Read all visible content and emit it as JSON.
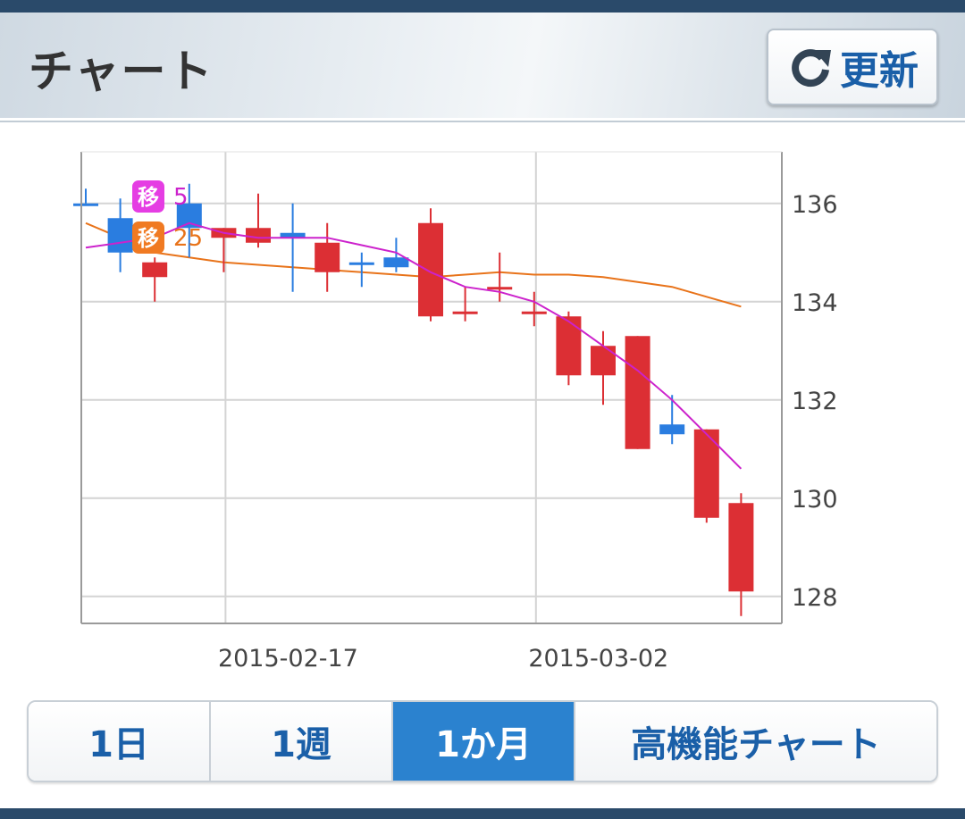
{
  "header": {
    "title": "チャート",
    "refresh_label": "更新",
    "refresh_icon": "refresh-icon"
  },
  "tabs": [
    {
      "label": "1日",
      "active": false
    },
    {
      "label": "1週",
      "active": false
    },
    {
      "label": "1か月",
      "active": true
    },
    {
      "label": "高機能チャート",
      "active": false
    }
  ],
  "chart_data": {
    "type": "candlestick",
    "y_ticks": [
      136,
      134,
      132,
      130,
      128
    ],
    "ylim": [
      127.45,
      137.05
    ],
    "x_tick_labels": [
      {
        "label": "2015-02-17",
        "index": 4
      },
      {
        "label": "2015-03-02",
        "index": 13
      }
    ],
    "grid": true,
    "legend": [
      {
        "badge": "移",
        "label": "5",
        "color": "#cc22cc",
        "badge_color": "#e53de3"
      },
      {
        "badge": "移",
        "label": "25",
        "color": "#e8731a",
        "badge_color": "#f07a22"
      }
    ],
    "colors": {
      "up": "#2a7de0",
      "down": "#dc2f34"
    },
    "candles": [
      {
        "o": 136.0,
        "h": 136.3,
        "l": 136.0,
        "c": 136.0,
        "dir": "up"
      },
      {
        "o": 135.0,
        "h": 136.1,
        "l": 134.6,
        "c": 135.7,
        "dir": "up"
      },
      {
        "o": 134.8,
        "h": 134.9,
        "l": 134.0,
        "c": 134.5,
        "dir": "down"
      },
      {
        "o": 135.5,
        "h": 136.4,
        "l": 134.9,
        "c": 136.0,
        "dir": "up"
      },
      {
        "o": 135.5,
        "h": 135.5,
        "l": 134.6,
        "c": 135.3,
        "dir": "down"
      },
      {
        "o": 135.5,
        "h": 136.2,
        "l": 135.1,
        "c": 135.2,
        "dir": "down"
      },
      {
        "o": 135.3,
        "h": 136.0,
        "l": 134.2,
        "c": 135.4,
        "dir": "up"
      },
      {
        "o": 135.2,
        "h": 135.6,
        "l": 134.2,
        "c": 134.6,
        "dir": "down"
      },
      {
        "o": 134.8,
        "h": 135.0,
        "l": 134.3,
        "c": 134.8,
        "dir": "up"
      },
      {
        "o": 134.7,
        "h": 135.3,
        "l": 134.6,
        "c": 134.9,
        "dir": "up"
      },
      {
        "o": 135.6,
        "h": 135.9,
        "l": 133.6,
        "c": 133.7,
        "dir": "down"
      },
      {
        "o": 133.8,
        "h": 134.3,
        "l": 133.6,
        "c": 133.8,
        "dir": "down"
      },
      {
        "o": 134.3,
        "h": 135.0,
        "l": 134.0,
        "c": 134.3,
        "dir": "down"
      },
      {
        "o": 133.8,
        "h": 134.2,
        "l": 133.5,
        "c": 133.8,
        "dir": "down"
      },
      {
        "o": 133.7,
        "h": 133.8,
        "l": 132.3,
        "c": 132.5,
        "dir": "down"
      },
      {
        "o": 133.1,
        "h": 133.4,
        "l": 131.9,
        "c": 132.5,
        "dir": "down"
      },
      {
        "o": 133.3,
        "h": 133.3,
        "l": 131.0,
        "c": 131.0,
        "dir": "down"
      },
      {
        "o": 131.3,
        "h": 132.1,
        "l": 131.1,
        "c": 131.5,
        "dir": "up"
      },
      {
        "o": 131.4,
        "h": 131.4,
        "l": 129.5,
        "c": 129.6,
        "dir": "down"
      },
      {
        "o": 129.9,
        "h": 130.1,
        "l": 127.6,
        "c": 128.1,
        "dir": "down"
      }
    ],
    "ma5": [
      135.1,
      135.2,
      135.3,
      135.6,
      135.4,
      135.3,
      135.3,
      135.3,
      135.15,
      135.0,
      134.6,
      134.3,
      134.2,
      134.0,
      133.6,
      133.1,
      132.6,
      132.0,
      131.3,
      130.6
    ],
    "ma25": [
      135.6,
      135.3,
      135.0,
      134.9,
      134.8,
      134.75,
      134.7,
      134.65,
      134.6,
      134.55,
      134.5,
      134.55,
      134.6,
      134.55,
      134.55,
      134.5,
      134.4,
      134.3,
      134.1,
      133.9
    ]
  }
}
